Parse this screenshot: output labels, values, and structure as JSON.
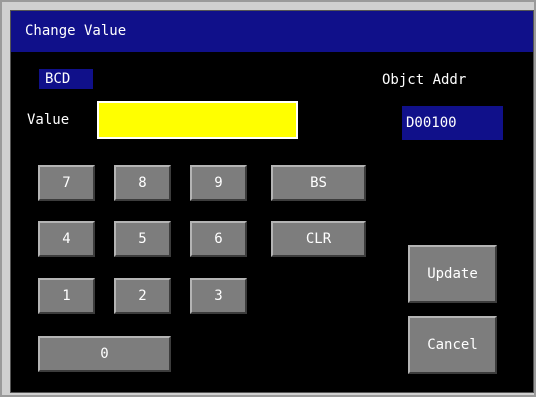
{
  "window": {
    "title": "Change Value"
  },
  "format_badge": "BCD",
  "value_label": "Value",
  "value_field": {
    "value": "",
    "color": "#ffff00"
  },
  "object_address": {
    "label": "Objct Addr",
    "value": "D00100"
  },
  "keypad": {
    "k7": "7",
    "k8": "8",
    "k9": "9",
    "bs": "BS",
    "k4": "4",
    "k5": "5",
    "k6": "6",
    "clr": "CLR",
    "k1": "1",
    "k2": "2",
    "k3": "3",
    "k0": "0"
  },
  "actions": {
    "update": "Update",
    "cancel": "Cancel"
  },
  "colors": {
    "title_bar": "#10108a",
    "background": "#000000",
    "button": "#7d7d7d",
    "input": "#ffff00"
  }
}
